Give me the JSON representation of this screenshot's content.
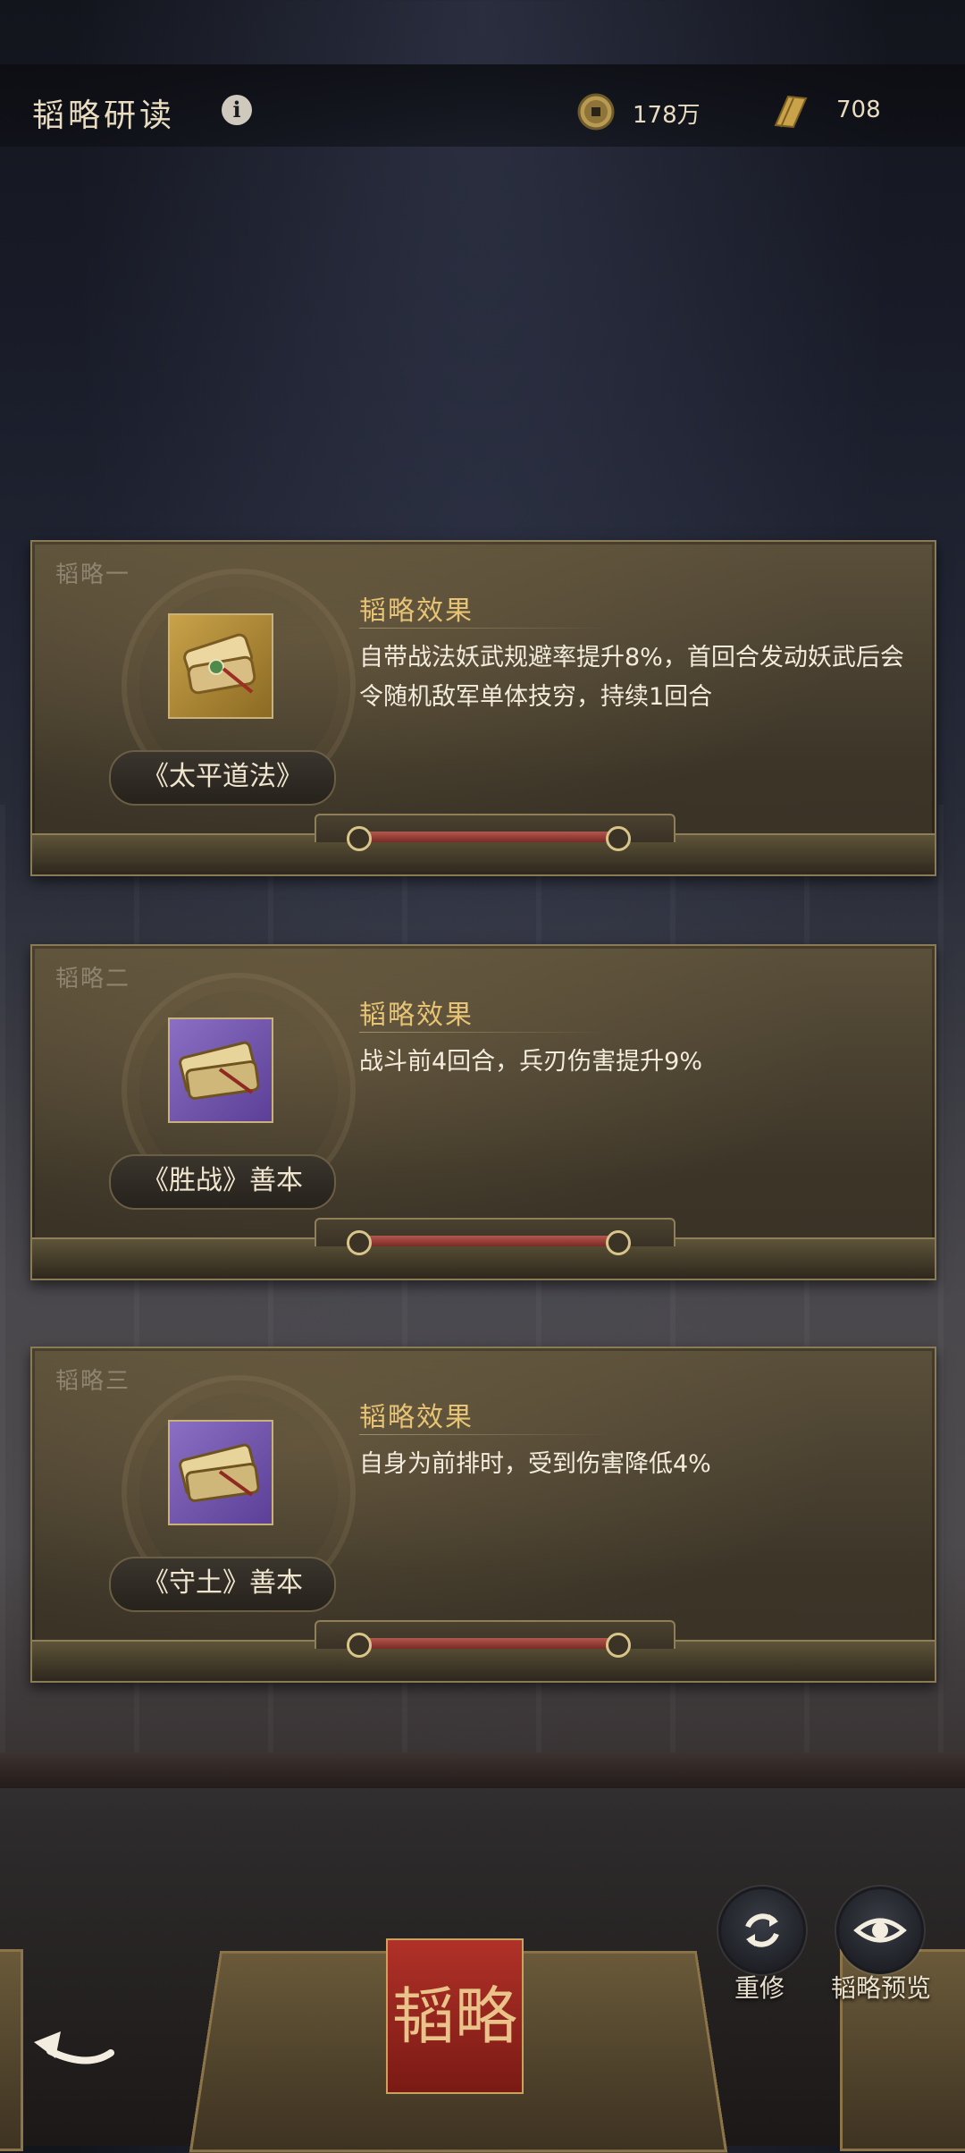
{
  "header": {
    "title": "韬略研读",
    "coins": "178万",
    "scrolls": "708"
  },
  "cards": [
    {
      "tag": "韬略一",
      "name": "《太平道法》",
      "effect_title": "韬略效果",
      "effect_text": "自带战法妖武规避率提升8%，首回合发动妖武后会令随机敌军单体技穷，持续1回合",
      "icon": "gold-book-icon"
    },
    {
      "tag": "韬略二",
      "name": "《胜战》善本",
      "effect_title": "韬略效果",
      "effect_text": "战斗前4回合，兵刃伤害提升9%",
      "icon": "purple-book-icon"
    },
    {
      "tag": "韬略三",
      "name": "《守土》善本",
      "effect_title": "韬略效果",
      "effect_text": "自身为前排时，受到伤害降低4%",
      "icon": "purple-book-icon"
    }
  ],
  "actions": {
    "retrain": "重修",
    "preview": "韬略预览"
  },
  "decor": {
    "seal_text": "韬略"
  },
  "colors": {
    "accent_gold": "#e7c375",
    "card_bg": "#4a4131",
    "strap_red": "#9b3b33"
  }
}
